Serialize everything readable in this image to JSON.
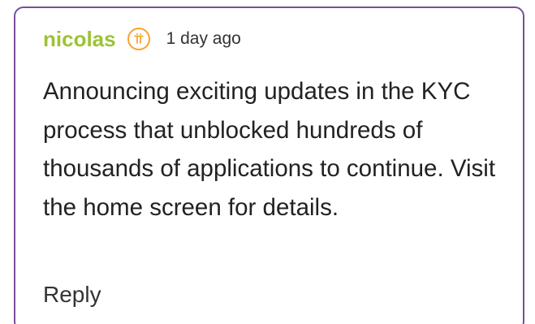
{
  "comment": {
    "author": "nicolas",
    "badge_icon": "pi-coin-icon",
    "timestamp": "1 day ago",
    "body": "Announcing exciting updates in the KYC process that unblocked hundreds of thousands of applications to continue. Visit the home screen for details.",
    "reply_label": "Reply"
  },
  "colors": {
    "border": "#7a4d9c",
    "author": "#9cc332",
    "badge": "#f7a430",
    "text": "#222222"
  }
}
